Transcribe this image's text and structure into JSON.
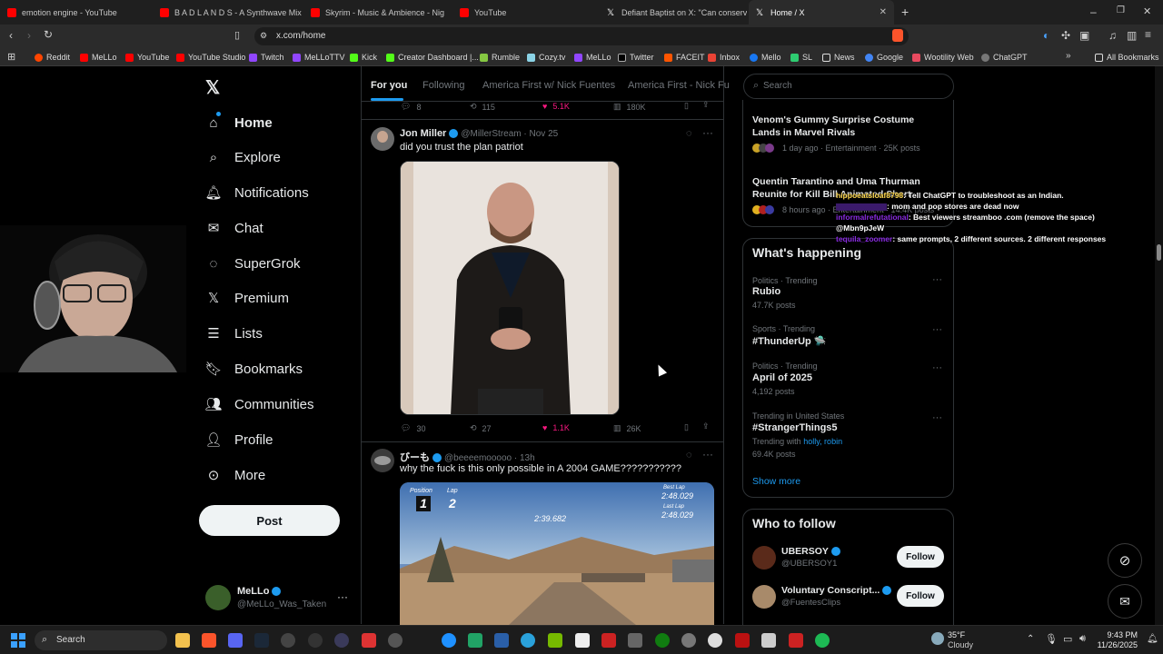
{
  "browser": {
    "tabs": [
      {
        "title": "emotion engine - YouTube",
        "color": "#ff0000"
      },
      {
        "title": "B A D L A N D S - A Synthwave Mix fo",
        "color": "#ff0000"
      },
      {
        "title": "Skyrim - Music & Ambience - Nig",
        "color": "#ff0000"
      },
      {
        "title": "YouTube",
        "color": "#ff0000"
      },
      {
        "title": "Defiant Baptist on X: \"Can conservativ",
        "color": "#ffffff"
      },
      {
        "title": "Home / X",
        "color": "#ffffff"
      }
    ],
    "url": "x.com/home",
    "bookmarks": [
      "Reddit",
      "MeLLo",
      "YouTube",
      "YouTube Studio",
      "Twitch",
      "MeLLoTTV",
      "Kick",
      "Creator Dashboard |...",
      "Rumble",
      "Cozy.tv",
      "MeLLo",
      "Twitter",
      "FACEIT",
      "Inbox",
      "Mello",
      "SL",
      "News",
      "Google",
      "Wootility Web",
      "ChatGPT"
    ],
    "all_bookmarks": "All Bookmarks"
  },
  "nav": {
    "items": [
      "Home",
      "Explore",
      "Notifications",
      "Chat",
      "SuperGrok",
      "Premium",
      "Lists",
      "Bookmarks",
      "Communities",
      "Profile",
      "More"
    ],
    "post_label": "Post",
    "account_name": "MeLLo",
    "account_handle": "@MeLLo_Was_Taken"
  },
  "feed": {
    "tabs": [
      "For you",
      "Following",
      "America First w/ Nick Fuentes",
      "America First - Nick Fu"
    ],
    "top_actions": {
      "replies": "8",
      "reposts": "115",
      "likes": "5.1K",
      "views": "180K"
    },
    "posts": [
      {
        "name": "Jon Miller",
        "handle": "@MillerStream",
        "time": "Nov 25",
        "text": "did you trust the plan patriot",
        "replies": "30",
        "reposts": "27",
        "likes": "1.1K",
        "views": "26K"
      },
      {
        "name": "びーも",
        "handle": "@beeeemooooo",
        "time": "13h",
        "text": "why the fuck is this only possible in A 2004 GAME???????????",
        "game_hud": {
          "position_label": "Position",
          "lap_label": "Lap",
          "position": "1",
          "lap": "2",
          "best_lap_label": "Best Lap",
          "best_lap": "2:48.029",
          "last_lap_label": "Last Lap",
          "last_lap": "2:48.029",
          "timer": "2:39.682"
        }
      }
    ]
  },
  "sidebar": {
    "search_placeholder": "Search",
    "top_trends": [
      {
        "title": "Venom's Gummy Surprise Costume Lands in Marvel Rivals",
        "meta": "1 day ago · Entertainment · 25K posts"
      },
      {
        "title": "Quentin Tarantino and Uma Thurman Reunite for Kill Bill Animated Short",
        "meta": "8 hours ago · Entertainment · 14.4K posts"
      }
    ],
    "whats_happening_title": "What's happening",
    "trends": [
      {
        "category": "Politics · Trending",
        "name": "Rubio",
        "count": "47.7K posts"
      },
      {
        "category": "Sports · Trending",
        "name": "#ThunderUp 🛸",
        "count": ""
      },
      {
        "category": "Politics · Trending",
        "name": "April of 2025",
        "count": "4,192 posts"
      },
      {
        "category": "Trending in United States",
        "name": "#StrangerThings5",
        "count": "69.4K posts",
        "trending_with": "Trending with",
        "trending_with_terms": "holly, robin"
      }
    ],
    "show_more": "Show more",
    "who_to_follow_title": "Who to follow",
    "suggestions": [
      {
        "name": "UBERSOY",
        "handle": "@UBERSOY1",
        "button": "Follow"
      },
      {
        "name": "Voluntary Conscript...",
        "handle": "@FuentesClips",
        "button": "Follow"
      }
    ]
  },
  "chat_overlay": [
    {
      "user": "hippoeatsloaf8798",
      "msg": ": Tell ChatGPT to troubleshoot as an Indian.",
      "color": "#ffd84d"
    },
    {
      "user": "",
      "msg": ": mom and pop stores are dead now",
      "color": "#8a2be2"
    },
    {
      "user": "informalrefutational",
      "msg": ": Best viewers streamboo .com (remove the space)",
      "color": "#8a2be2"
    },
    {
      "user": "",
      "msg": "@Mbn9pJeW",
      "color": "#ffffff"
    },
    {
      "user": "tequila_zoomer",
      "msg": ": same prompts, 2 different sources. 2 different responses",
      "color": "#8a2be2"
    }
  ],
  "taskbar": {
    "search_label": "Search",
    "weather_temp": "35°F",
    "weather_text": "Cloudy",
    "time": "9:43 PM",
    "date": "11/26/2025"
  }
}
